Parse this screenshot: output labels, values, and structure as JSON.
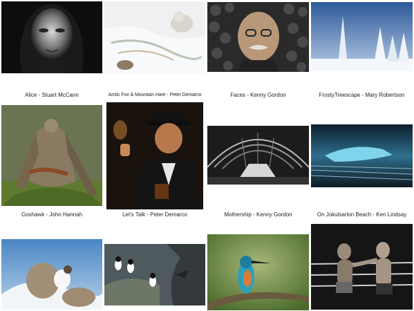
{
  "gallery": {
    "items": [
      {
        "caption": "Alice - Stuart McCann"
      },
      {
        "caption": "Arctic Fox & Mountain Hare - Peter Demarco"
      },
      {
        "caption": "Faces - Kenny Gordon"
      },
      {
        "caption": "FrostyTreescape - Mary Robertson"
      },
      {
        "caption": "Goshawk - John Hannah"
      },
      {
        "caption": "Let's Talk - Peter Demarco"
      },
      {
        "caption": "Mothership - Kenny Gordon"
      },
      {
        "caption": "On Jokulsarlon Beach - Ken Lindsay"
      },
      {
        "caption": ""
      },
      {
        "caption": ""
      },
      {
        "caption": ""
      },
      {
        "caption": ""
      }
    ]
  }
}
